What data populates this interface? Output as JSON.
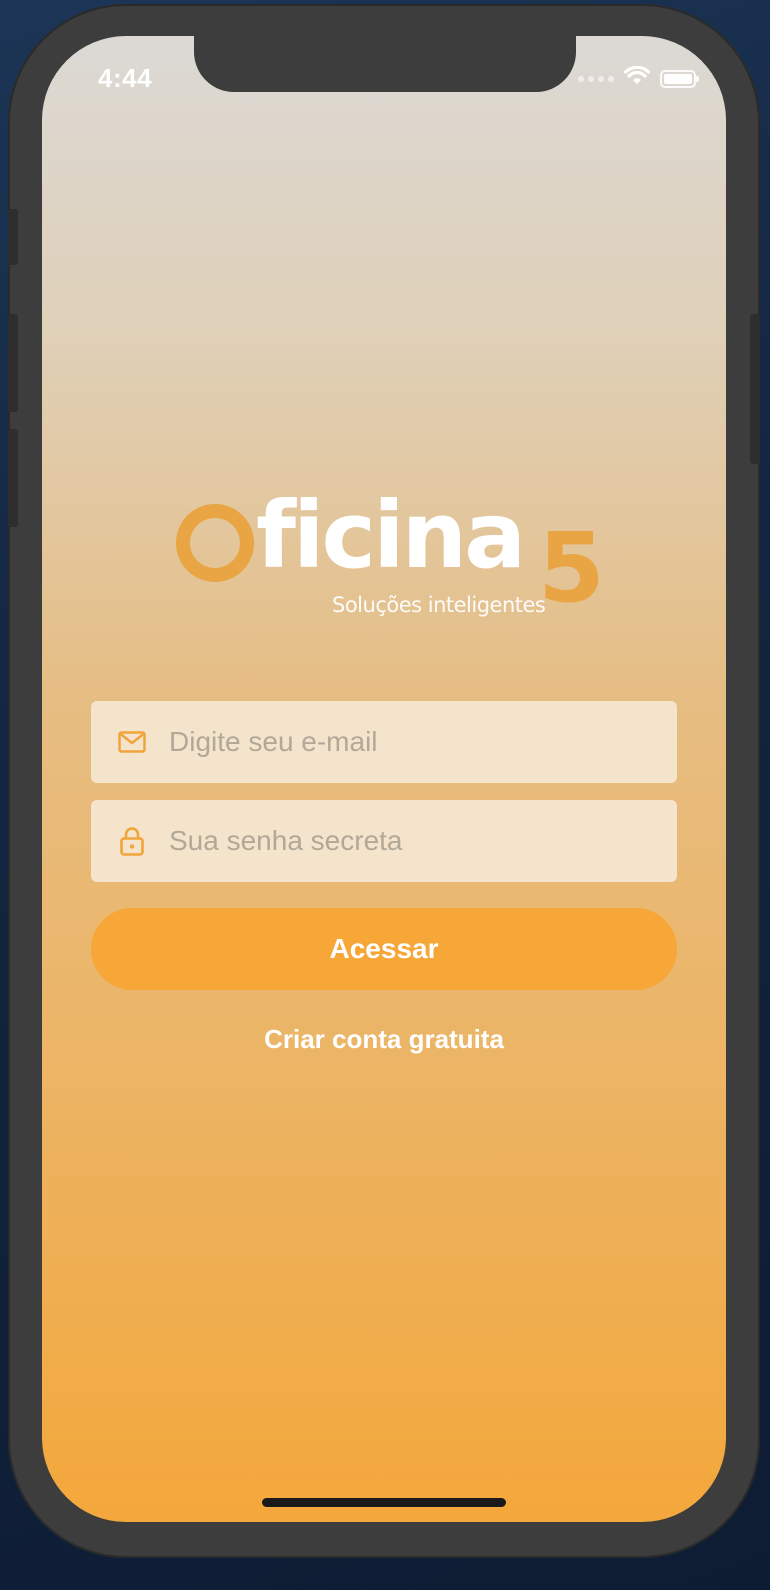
{
  "status_bar": {
    "time": "4:44",
    "icons": [
      "signal-dots-icon",
      "wifi-icon",
      "battery-icon"
    ]
  },
  "logo": {
    "word": "ficina",
    "number": "5",
    "tagline": "Soluções inteligentes"
  },
  "login_form": {
    "email_placeholder": "Digite seu e-mail",
    "email_value": "",
    "email_icon": "mail-icon",
    "password_placeholder": "Sua senha secreta",
    "password_value": "",
    "password_icon": "lock-icon",
    "submit_label": "Acessar",
    "create_account_label": "Criar conta gratuita"
  },
  "colors": {
    "accent": "#f6a737",
    "logo_orange": "#e9a443",
    "field_bg": "#f4e4cb",
    "placeholder": "#b2a898"
  }
}
